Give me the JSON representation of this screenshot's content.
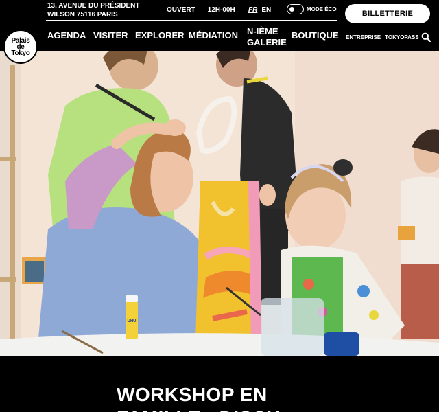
{
  "header": {
    "logo_lines": [
      "Palais",
      "de",
      "Tokyo"
    ],
    "address_line1": "13, AVENUE DU PRÉSIDENT",
    "address_line2": "WILSON 75116 PARIS",
    "open_label": "OUVERT",
    "hours": "12H-00H",
    "lang_fr": "FR",
    "lang_en": "EN",
    "eco_mode_label": "MODE ÉCO",
    "ticket_button": "BILLETTERIE"
  },
  "nav": {
    "items": [
      {
        "label": "AGENDA"
      },
      {
        "label": "VISITER"
      },
      {
        "label": "EXPLORER"
      },
      {
        "label": "MÉDIATION"
      },
      {
        "label_line1": "N-IÈME",
        "label_line2": "GALERIE"
      },
      {
        "label": "BOUTIQUE"
      }
    ],
    "sub": {
      "entreprise": "ENTREPRISE",
      "tokyopass": "TOKYOPASS"
    }
  },
  "hero": {
    "image_alt": "",
    "glue_label": "UHU"
  },
  "content": {
    "title_line1": "WORKSHOP EN",
    "title_line2": "FAMILLE : DISCU"
  },
  "colors": {
    "background": "#000000",
    "text": "#ffffff",
    "button_bg": "#ffffff"
  }
}
